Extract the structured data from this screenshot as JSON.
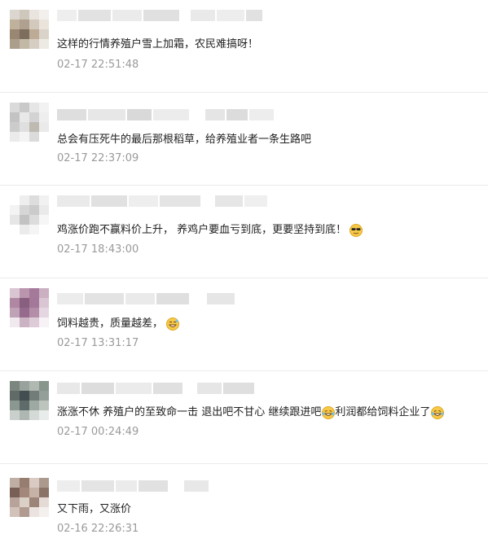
{
  "comments": [
    {
      "text": "这样的行情养殖户雪上加霜，农民难搞呀！",
      "time": "02-17 22:51:48",
      "emojis": [],
      "avatar_colors": [
        "#d8d2ca",
        "#c9c1b5",
        "#e7e2db",
        "#f1eeea",
        "#b9a991",
        "#a79684",
        "#cfc4b6",
        "#e8e2d9",
        "#8e7b66",
        "#6f5e4c",
        "#b6a38b",
        "#d6cfc4",
        "#a2957f",
        "#bdb09d",
        "#d2c9bc",
        "#ece8e2"
      ]
    },
    {
      "text": "总会有压死牛的最后那根稻草，给养殖业者一条生路吧",
      "time": "02-17 22:37:09",
      "emojis": [],
      "avatar_colors": [
        "#d6d6d6",
        "#c4c4c4",
        "#e4e4e4",
        "#f1f1f1",
        "#bdbdbd",
        "#e6e6e6",
        "#cfcfcf",
        "#ededed",
        "#c7c7c7",
        "#dcdcdc",
        "#b8b3aa",
        "#e8e8e8",
        "#e9e9e9",
        "#f3f3f3",
        "#d8d8d8",
        "#ffffff"
      ]
    },
    {
      "text": "鸡涨价跑不赢料价上升， 养鸡户要血亏到底，更要坚持到底！",
      "time": "02-17 18:43:00",
      "emojis": [
        "cool-emoji"
      ],
      "avatar_colors": [
        "#ffffff",
        "#ededed",
        "#dadada",
        "#f0f0f0",
        "#f2f2f2",
        "#d2d2d2",
        "#c6c6c6",
        "#e8e8e8",
        "#e4e4e4",
        "#bcbcbc",
        "#d9d9d9",
        "#f6f6f6",
        "#ffffff",
        "#e9e9e9",
        "#f4f4f4",
        "#ffffff"
      ]
    },
    {
      "text": "饲料越贵，质量越差，",
      "time": "02-17 13:31:17",
      "emojis": [
        "grin-sweat-emoji"
      ],
      "avatar_colors": [
        "#d7bfcf",
        "#b48aa6",
        "#9b6b8f",
        "#c5a8bb",
        "#a77b99",
        "#7d4e73",
        "#9a6a8e",
        "#d6c0ce",
        "#b999ad",
        "#8a5a80",
        "#ac82a0",
        "#e3d3de",
        "#efe7ec",
        "#c7abbd",
        "#dac6d3",
        "#f6f1f4"
      ]
    },
    {
      "text": "涨涨不休 养殖户的至致命一击 退出吧不甘心 继续跟进吧",
      "text2": "利润都给饲料企业了",
      "time": "02-17 00:24:49",
      "emojis": [
        "laugh-cry-emoji",
        "laugh-cry-emoji"
      ],
      "avatar_colors": [
        "#6d7a72",
        "#8f9992",
        "#a8b1aa",
        "#7c8a80",
        "#4f5c58",
        "#2e3b3c",
        "#63706c",
        "#8a958f",
        "#7f8c86",
        "#4d5b5a",
        "#94a09a",
        "#b6beb8",
        "#c5ccc7",
        "#a7b0aa",
        "#d0d6d2",
        "#e6ebe8"
      ]
    },
    {
      "text": "又下雨，又涨价",
      "time": "02-16 22:26:31",
      "emojis": [],
      "avatar_colors": [
        "#b9a69a",
        "#8c6f61",
        "#d5c6bd",
        "#a48e82",
        "#6a4e44",
        "#9a7b6d",
        "#c2aa9e",
        "#806457",
        "#b09a8f",
        "#d8cbc3",
        "#93776a",
        "#e3d8d2",
        "#cdbcb3",
        "#a99085",
        "#e9e1dc",
        "#f3efec"
      ]
    }
  ]
}
